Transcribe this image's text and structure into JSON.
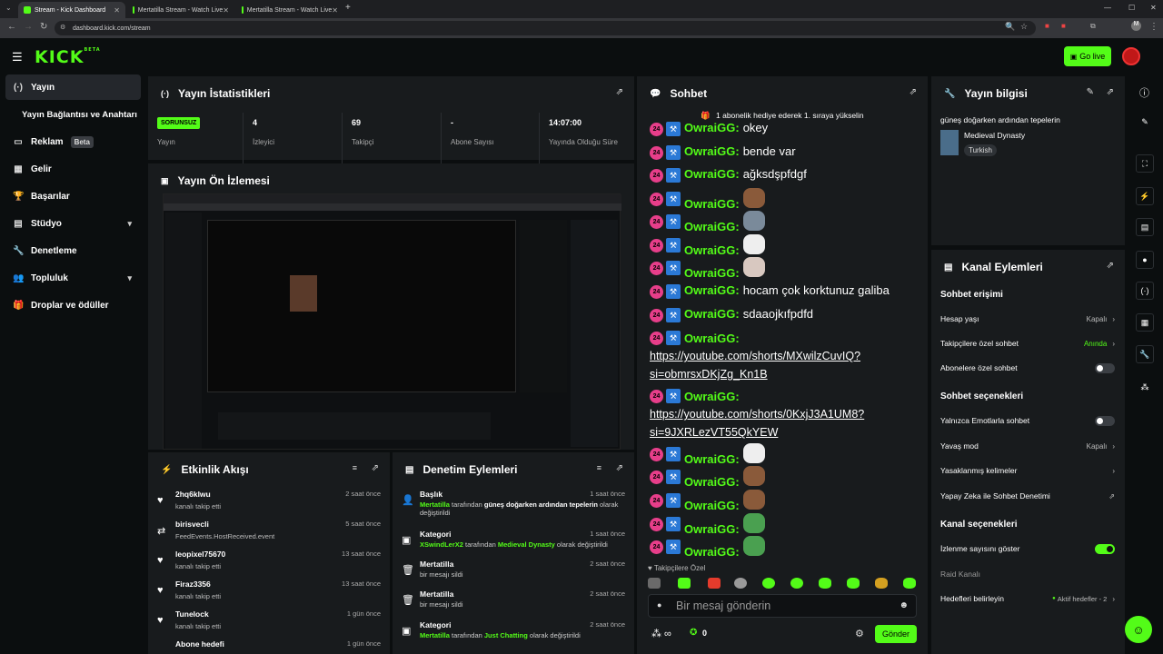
{
  "browser": {
    "tabs": [
      {
        "title": "Stream - Kick Dashboard",
        "active": true
      },
      {
        "title": "Mertatilla Stream - Watch Live",
        "active": false
      },
      {
        "title": "Mertatilla Stream - Watch Live",
        "active": false
      }
    ],
    "new_tab": "+",
    "url": "dashboard.kick.com/stream"
  },
  "header": {
    "logo": "KICK",
    "logo_sup": "BETA",
    "go_live": "Go live"
  },
  "sidebar": {
    "items": [
      {
        "label": "Yayın",
        "icon": "broadcast-icon"
      },
      {
        "label": "Yayın Bağlantısı ve Anahtarı",
        "icon": ""
      },
      {
        "label": "Reklam",
        "icon": "ad-icon",
        "badge": "Beta"
      },
      {
        "label": "Gelir",
        "icon": "chart-icon"
      },
      {
        "label": "Başarılar",
        "icon": "trophy-icon"
      },
      {
        "label": "Stüdyo",
        "icon": "studio-icon"
      },
      {
        "label": "Denetleme",
        "icon": "wrench-icon"
      },
      {
        "label": "Topluluk",
        "icon": "community-icon"
      },
      {
        "label": "Droplar ve ödüller",
        "icon": "gift-icon"
      }
    ]
  },
  "stats": {
    "title": "Yayın İstatistikleri",
    "status_badge": "SORUNSUZ",
    "status_label": "Yayın",
    "viewers": "4",
    "viewers_label": "İzleyici",
    "followers": "69",
    "followers_label": "Takipçi",
    "subs": "-",
    "subs_label": "Abone Sayısı",
    "uptime": "14:07:00",
    "uptime_label": "Yayında Olduğu Süre"
  },
  "preview": {
    "title": "Yayın Ön İzlemesi"
  },
  "activity": {
    "title": "Etkinlik Akışı",
    "items": [
      {
        "name": "2hq6klwu",
        "sub": "kanalı takip etti",
        "time": "2 saat önce"
      },
      {
        "name": "birisvecli",
        "sub": "FeedEvents.HostReceived.event",
        "time": "5 saat önce"
      },
      {
        "name": "leopixel75670",
        "sub": "kanalı takip etti",
        "time": "13 saat önce"
      },
      {
        "name": "Firaz3356",
        "sub": "kanalı takip etti",
        "time": "13 saat önce"
      },
      {
        "name": "Tunelock",
        "sub": "kanalı takip etti",
        "time": "1 gün önce"
      },
      {
        "name": "Abone hedefi",
        "sub": "",
        "time": "1 gün önce"
      }
    ]
  },
  "moderation": {
    "title": "Denetim Eylemleri",
    "items": [
      {
        "name": "Başlık",
        "actor": "Mertatilla",
        "mid": " tarafından ",
        "target": "güneş doğarken ardından tepelerin",
        "end": " olarak değiştirildi",
        "time": "1 saat önce"
      },
      {
        "name": "Kategori",
        "actor": "XSwindLerX2",
        "mid": " tarafından ",
        "target": "Medieval Dynasty",
        "end": " olarak değiştirildi",
        "time": "1 saat önce"
      },
      {
        "name": "Mertatilla",
        "actor": "",
        "mid": "bir mesajı sildi",
        "target": "",
        "end": "",
        "time": "2 saat önce"
      },
      {
        "name": "Mertatilla",
        "actor": "",
        "mid": "bir mesajı sildi",
        "target": "",
        "end": "",
        "time": "2 saat önce"
      },
      {
        "name": "Kategori",
        "actor": "Mertatilla",
        "mid": " tarafından ",
        "target": "Just Chatting",
        "end": " olarak değiştirildi",
        "time": "2 saat önce"
      }
    ]
  },
  "chat": {
    "title": "Sohbet",
    "pinned": "1 abonelik hediye ederek 1. sıraya yükselin",
    "sub_badge": "24",
    "username": "OwraiGG",
    "messages": [
      {
        "text": "okey"
      },
      {
        "text": "bende var"
      },
      {
        "text": "ağksdşpfdgf"
      },
      {
        "emote": "brown-bear-emote"
      },
      {
        "emote": "grey-creature-emote"
      },
      {
        "emote": "white-cat-emote"
      },
      {
        "emote": "pointing-cat-emote"
      },
      {
        "text": "hocam çok korktunuz galiba"
      },
      {
        "text": "sdaaojkıfpdfd"
      },
      {
        "link1": "https://youtube.com/shorts/MXwilzCuvIQ?",
        "link2": "si=obmrsxDKjZg_Kn1B"
      },
      {
        "link1": "https://youtube.com/shorts/0KxjJ3A1UM8?",
        "link2": "si=9JXRLezVT55QkYEW"
      },
      {
        "emote": "white-cat-emote"
      },
      {
        "emote": "brown-bear-emote"
      },
      {
        "emote": "brown-bear-emote"
      },
      {
        "emote": "frog-emote"
      },
      {
        "emote": "frog-emote"
      }
    ],
    "followers_only": "Takipçilere Özel",
    "input_placeholder": "Bir mesaj gönderin",
    "points": "0",
    "send": "Gönder"
  },
  "stream_info": {
    "title": "Yayın bilgisi",
    "stream_title": "güneş doğarken ardından tepelerin",
    "category": "Medieval Dynasty",
    "language": "Turkish"
  },
  "channel_actions": {
    "title": "Kanal Eylemleri",
    "chat_access": "Sohbet erişimi",
    "account_age": "Hesap yaşı",
    "account_age_val": "Kapalı",
    "followers_chat": "Takipçilere özel sohbet",
    "followers_chat_val": "Anında",
    "subs_chat": "Abonelere özel sohbet",
    "chat_options": "Sohbet seçenekleri",
    "emote_only": "Yalnızca Emotlarla sohbet",
    "slow_mode": "Yavaş mod",
    "slow_mode_val": "Kapalı",
    "banned_words": "Yasaklanmış kelimeler",
    "ai_moderation": "Yapay Zeka ile Sohbet Denetimi",
    "channel_options": "Kanal seçenekleri",
    "show_viewers": "İzlenme sayısını göster",
    "raid_channel": "Raid Kanalı",
    "goals": "Hedefleri belirleyin",
    "goals_val": "Aktif hedefler - 2"
  },
  "colors": {
    "accent": "#53fc18",
    "sub_badge": "#e73e8a",
    "mod_badge": "#2b79d6",
    "panel": "#181b1d",
    "bg": "#0b0e0f"
  }
}
